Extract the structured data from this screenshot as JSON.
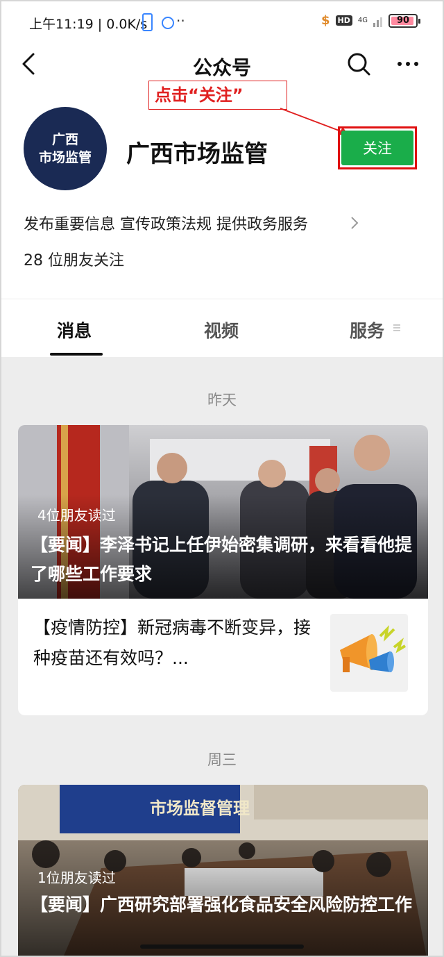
{
  "status_bar": {
    "time_speed": "上午11:19 | 0.0K/s",
    "more": "··",
    "hd": "HD",
    "network": "4G",
    "battery": "90"
  },
  "nav": {
    "title": "公众号"
  },
  "annotation": {
    "text": "点击“关注”",
    "color": "#e02020"
  },
  "profile": {
    "avatar_line1": "广西",
    "avatar_line2": "市场监管",
    "name": "广西市场监管",
    "follow_label": "关注",
    "description": "发布重要信息 宣传政策法规 提供政务服务",
    "followers": "28 位朋友关注"
  },
  "tabs": [
    {
      "label": "消息",
      "active": true
    },
    {
      "label": "视频",
      "active": false
    },
    {
      "label": "服务",
      "active": false
    }
  ],
  "feed": [
    {
      "day": "昨天",
      "hero": {
        "read_count": "4位朋友读过",
        "title": "【要闻】李泽书记上任伊始密集调研，来看看他提了哪些工作要求"
      },
      "sub_item": {
        "title": "【疫情防控】新冠病毒不断变异，接种疫苗还有效吗？..."
      }
    },
    {
      "day": "周三",
      "hero": {
        "banner_text": "市场监督管理",
        "read_count": "1位朋友读过",
        "title": "【要闻】广西研究部署强化食品安全风险防控工作"
      }
    }
  ],
  "colors": {
    "follow_green": "#1aad4a",
    "avatar_bg": "#1a2a54",
    "feed_bg": "#ededed"
  }
}
